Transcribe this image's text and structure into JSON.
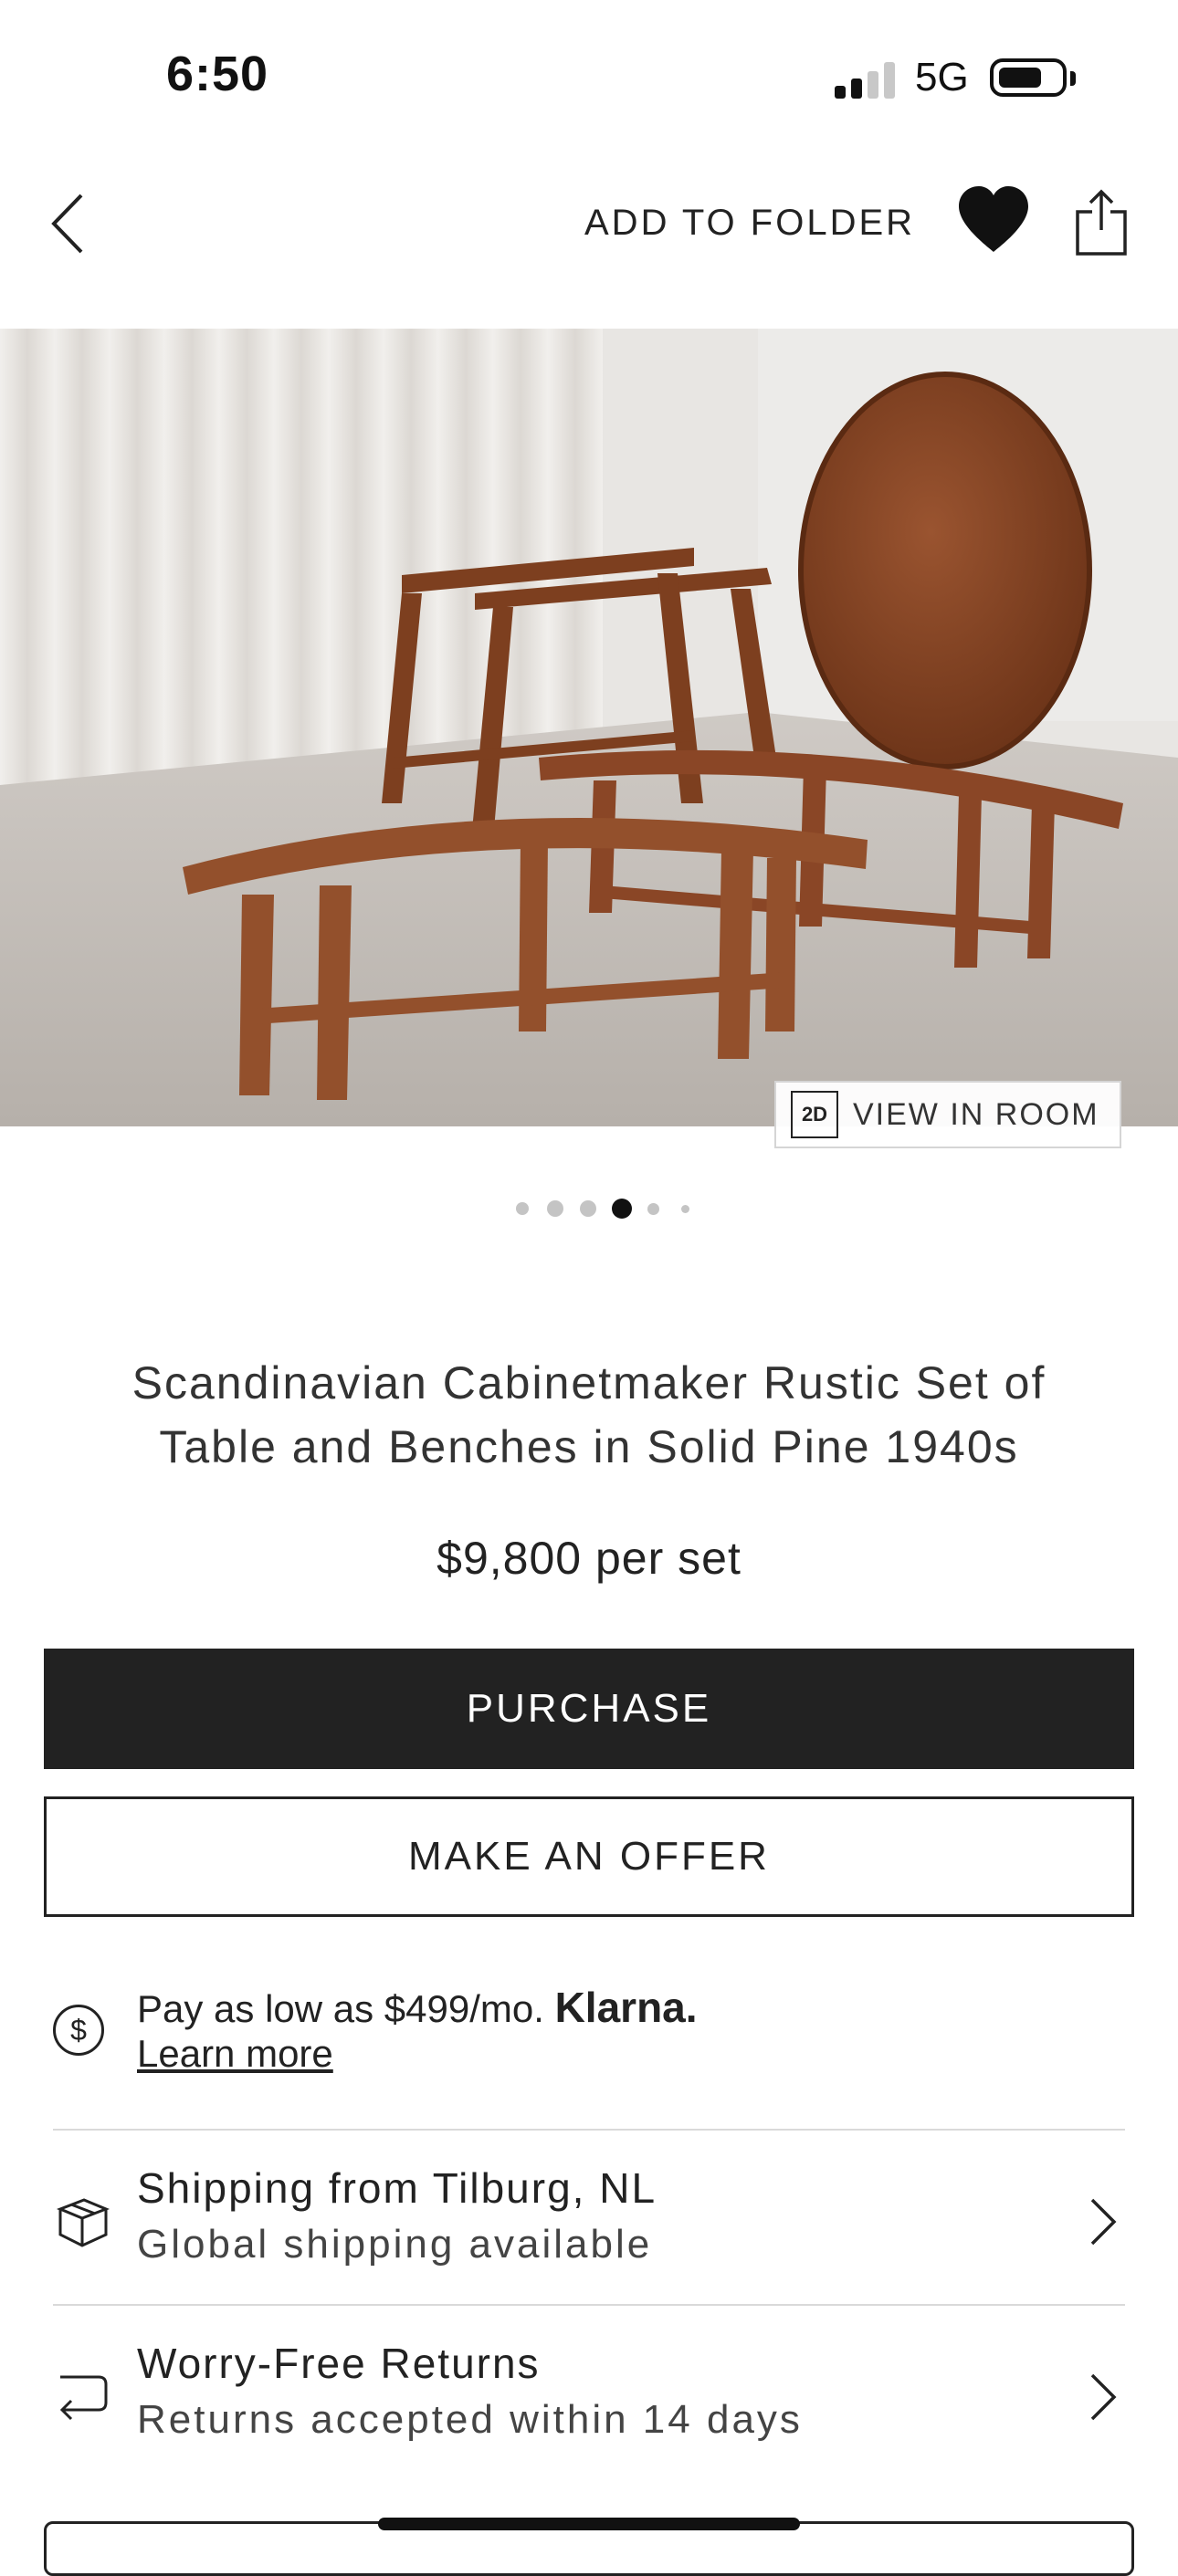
{
  "status_bar": {
    "time": "6:50",
    "network": "5G",
    "signal_bars_active": 2,
    "signal_bars_total": 4,
    "battery_icon": "battery-icon"
  },
  "nav": {
    "back_icon": "chevron-left-icon",
    "add_to_folder": "ADD TO FOLDER",
    "favorite_icon": "heart-icon",
    "share_icon": "share-icon"
  },
  "gallery": {
    "view_in_room_badge": "2D",
    "view_in_room": "VIEW IN ROOM",
    "dot_count": 6,
    "active_dot": 4
  },
  "product": {
    "title_line1": "Scandinavian Cabinetmaker Rustic Set of",
    "title_line2": "Table and Benches in Solid Pine 1940s",
    "price": "$9,800 per set"
  },
  "actions": {
    "purchase": "PURCHASE",
    "make_offer": "MAKE AN OFFER"
  },
  "financing": {
    "icon": "dollar-circle-icon",
    "text": "Pay as low as $499/mo. ",
    "brand": "Klarna.",
    "learn_more": "Learn more"
  },
  "shipping": {
    "icon": "package-icon",
    "title": "Shipping from Tilburg, NL",
    "subtitle": "Global shipping available"
  },
  "returns": {
    "icon": "return-arrow-icon",
    "title": "Worry-Free Returns",
    "subtitle": "Returns accepted within 14 days"
  },
  "colors": {
    "primary_button": "#222222",
    "background": "#ffffff",
    "divider": "#d9d9d9",
    "wood": "#8a4a2a"
  }
}
